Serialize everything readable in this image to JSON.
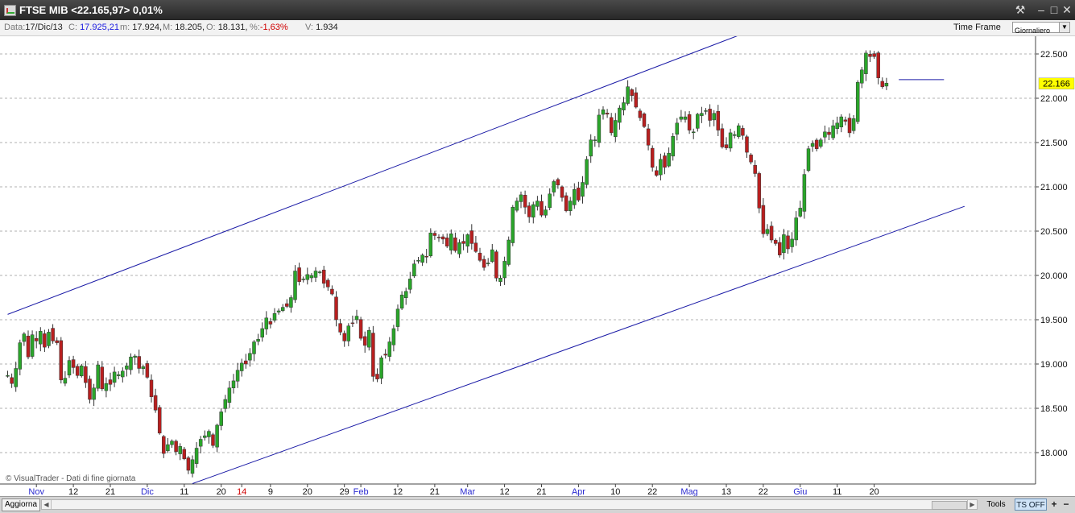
{
  "window": {
    "title": "FTSE MIB <22.165,97> 0,01%"
  },
  "info": {
    "data_label": "Data:",
    "data_value": "17/Dic/13",
    "c_label": "C:",
    "c_value": "17.925,21",
    "m_label": "m:",
    "m_value": "17.924,",
    "mx_label": "M:",
    "mx_value": "18.205,",
    "o_label": "O:",
    "o_value": "18.131,",
    "pct_label": "%:",
    "pct_value": "-1,63%",
    "v_label": "V:",
    "v_value": "1.934",
    "timeframe_label": "Time Frame",
    "timeframe_value": "Giornaliero"
  },
  "footer": {
    "aggiorna": "Aggiorna",
    "tools": "Tools",
    "ts": "TS OFF",
    "zoom_in": "+",
    "zoom_out": "−"
  },
  "colors": {
    "up": "#2aa52a",
    "down": "#b81f1f",
    "trend": "#1a1aa6",
    "last": "#ffff00",
    "grid": "#b0b0b0"
  },
  "chart_data": {
    "type": "candlestick",
    "watermark": "© VisualTrader - Dati di fine giornata",
    "ylim": [
      17700,
      22700
    ],
    "y_ticks": [
      22500,
      22000,
      21500,
      21000,
      20500,
      20000,
      19500,
      19000,
      18500,
      18000
    ],
    "y_tick_labels": [
      "22.500",
      "22.000",
      "21.500",
      "21.000",
      "20.500",
      "20.000",
      "19.500",
      "19.000",
      "18.500",
      "18.000"
    ],
    "last_value": 22165.97,
    "last_label": "22.166",
    "x_tick_labels": [
      {
        "label": "Nov",
        "index": 7,
        "month": true
      },
      {
        "label": "12",
        "index": 16,
        "month": false
      },
      {
        "label": "21",
        "index": 25,
        "month": false
      },
      {
        "label": "Dic",
        "index": 34,
        "month": true
      },
      {
        "label": "11",
        "index": 43,
        "month": false
      },
      {
        "label": "20",
        "index": 52,
        "month": false
      },
      {
        "label": "14",
        "index": 57,
        "month": false,
        "red": true
      },
      {
        "label": "9",
        "index": 64,
        "month": false
      },
      {
        "label": "20",
        "index": 73,
        "month": false
      },
      {
        "label": "29",
        "index": 82,
        "month": false
      },
      {
        "label": "Feb",
        "index": 86,
        "month": true
      },
      {
        "label": "12",
        "index": 95,
        "month": false
      },
      {
        "label": "21",
        "index": 104,
        "month": false
      },
      {
        "label": "Mar",
        "index": 112,
        "month": true
      },
      {
        "label": "12",
        "index": 121,
        "month": false
      },
      {
        "label": "21",
        "index": 130,
        "month": false
      },
      {
        "label": "Apr",
        "index": 139,
        "month": true
      },
      {
        "label": "10",
        "index": 148,
        "month": false
      },
      {
        "label": "22",
        "index": 157,
        "month": false
      },
      {
        "label": "Mag",
        "index": 166,
        "month": true
      },
      {
        "label": "13",
        "index": 175,
        "month": false
      },
      {
        "label": "22",
        "index": 184,
        "month": false
      },
      {
        "label": "Giu",
        "index": 193,
        "month": true
      },
      {
        "label": "11",
        "index": 202,
        "month": false
      },
      {
        "label": "20",
        "index": 211,
        "month": false
      }
    ],
    "closes": [
      18870,
      18780,
      18950,
      19240,
      19340,
      19080,
      19330,
      19260,
      19370,
      19190,
      19360,
      19260,
      19240,
      18820,
      18840,
      19040,
      18960,
      18870,
      18980,
      18790,
      18600,
      18730,
      18990,
      18720,
      18780,
      18770,
      18910,
      18880,
      18920,
      18980,
      19080,
      19090,
      18950,
      18970,
      18850,
      18630,
      18480,
      18220,
      17990,
      18090,
      18130,
      18010,
      18070,
      17930,
      17800,
      17920,
      18050,
      18150,
      18190,
      18240,
      18080,
      18310,
      18460,
      18600,
      18730,
      18810,
      18930,
      19010,
      19000,
      19120,
      19250,
      19280,
      19400,
      19520,
      19450,
      19570,
      19600,
      19640,
      19650,
      19750,
      20050,
      19930,
      19960,
      20010,
      20000,
      20050,
      20040,
      19910,
      19870,
      19790,
      19500,
      19360,
      19260,
      19430,
      19460,
      19540,
      19290,
      19210,
      19380,
      18860,
      18830,
      19070,
      19100,
      19250,
      19400,
      19620,
      19780,
      19820,
      19960,
      20130,
      20170,
      20230,
      20210,
      20480,
      20450,
      20430,
      20410,
      20330,
      20470,
      20280,
      20370,
      20360,
      20460,
      20360,
      20270,
      20170,
      20090,
      20140,
      20290,
      19970,
      19970,
      20160,
      20400,
      20770,
      20840,
      20910,
      20770,
      20660,
      20800,
      20840,
      20680,
      20740,
      20920,
      21060,
      21020,
      20880,
      20730,
      20840,
      20970,
      20850,
      21050,
      21310,
      21530,
      21530,
      21810,
      21870,
      21820,
      21610,
      21750,
      21890,
      21950,
      22130,
      22030,
      21900,
      21780,
      21680,
      21470,
      21220,
      21130,
      21310,
      21220,
      21380,
      21570,
      21720,
      21790,
      21790,
      21640,
      21620,
      21820,
      21830,
      21860,
      21750,
      21830,
      21640,
      21450,
      21440,
      21610,
      21590,
      21690,
      21580,
      21390,
      21280,
      21150,
      20760,
      20470,
      20520,
      20400,
      20360,
      20230,
      20460,
      20300,
      20410,
      20650,
      20760,
      21140,
      21430,
      21490,
      21430,
      21530,
      21620,
      21590,
      21690,
      21720,
      21790,
      21740,
      21610,
      21770,
      22180,
      22320,
      22510,
      22470,
      22470,
      22230,
      22130,
      22170
    ],
    "trendlines": [
      {
        "points": [
          [
            0,
            19560
          ],
          [
            178,
            22710
          ]
        ]
      },
      {
        "points": [
          [
            45,
            17650
          ],
          [
            233,
            20780
          ]
        ]
      },
      {
        "points": [
          [
            217,
            22210
          ],
          [
            228,
            22210
          ]
        ]
      }
    ]
  }
}
